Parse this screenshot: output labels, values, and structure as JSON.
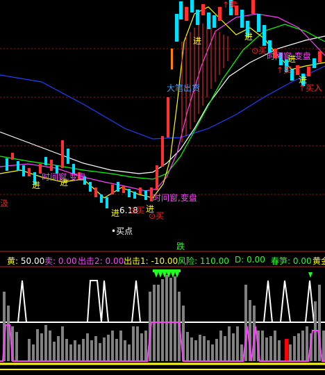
{
  "chart_data": [
    {
      "type": "candlestick",
      "panel": "main",
      "title": "",
      "annotations": [
        {
          "text": "↑卖",
          "color": "#ff2020"
        },
        {
          "text": "进",
          "color": "#ffff00"
        },
        {
          "text": "⊙买",
          "color": "#ff2020"
        },
        {
          "text": "时间窗,变盘",
          "color": "#ff40ff"
        },
        {
          "text": "进",
          "color": "#ffff00"
        },
        {
          "text": "大笔出货",
          "color": "#40a0ff"
        },
        {
          "text": "↑买",
          "color": "#ff2020"
        },
        {
          "text": "进",
          "color": "#ffff00"
        },
        {
          "text": "进",
          "color": "#ffff00"
        },
        {
          "text": "时间窗,变盘",
          "color": "#ff40ff"
        },
        {
          "text": "进",
          "color": "#ffff00"
        },
        {
          "text": "进",
          "color": "#ffff00"
        },
        {
          "text": "6.18",
          "color": "#ffffff"
        },
        {
          "text": "⊙买",
          "color": "#ff2020"
        },
        {
          "text": "进",
          "color": "#ffff00"
        },
        {
          "text": "⊙买",
          "color": "#ff2020"
        },
        {
          "text": "时间窗,变盘",
          "color": "#ff40ff"
        },
        {
          "text": "•买点",
          "color": "#ffffff"
        },
        {
          "text": "跌",
          "color": "#20ff20"
        },
        {
          "text": "汲",
          "color": "#ff2020"
        },
        {
          "text": "↑买入",
          "color": "#ff2020"
        },
        {
          "text": "进",
          "color": "#ffff00"
        }
      ],
      "moving_averages": [
        "white",
        "yellow",
        "magenta",
        "green",
        "blue"
      ]
    },
    {
      "type": "bar",
      "panel": "indicator",
      "series": [
        {
          "name": "黄",
          "value": "50.00"
        },
        {
          "name": "卖",
          "value": "0.00"
        },
        {
          "name": "出击2",
          "value": "0.00"
        },
        {
          "name": "出击1",
          "value": "-10.00"
        },
        {
          "name": "风险",
          "value": "110.00"
        },
        {
          "name": "D",
          "value": "0.00"
        },
        {
          "name": "春笋",
          "value": "0.00"
        },
        {
          "name": "黄金",
          "value": ""
        }
      ]
    }
  ],
  "colors": {
    "up": "#ff3030",
    "down": "#00e0ff",
    "ma_white": "#ffffff",
    "ma_yellow": "#ffff00",
    "ma_magenta": "#ff40ff",
    "ma_green": "#00ff00",
    "ma_blue": "#2040ff"
  }
}
